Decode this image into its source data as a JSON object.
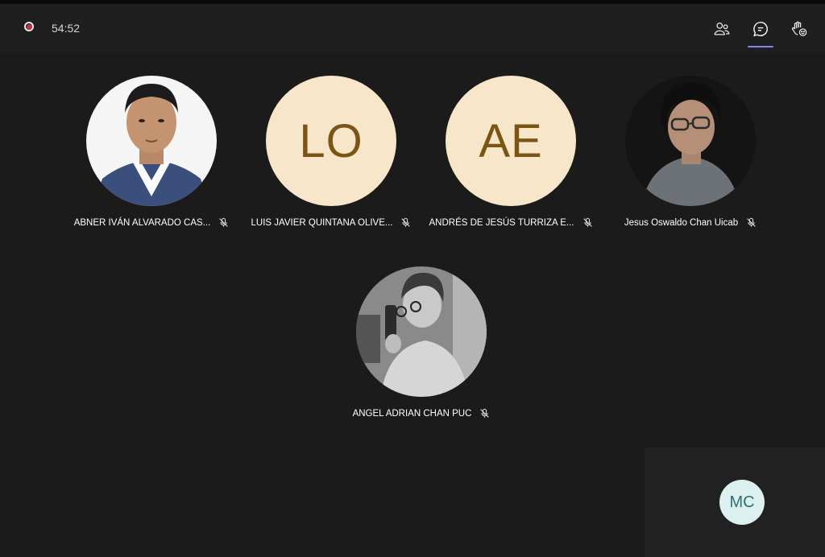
{
  "call": {
    "timer": "54:52",
    "recording_indicator_icon": "record-icon",
    "toolbar": [
      {
        "name": "participants",
        "icon": "people-icon"
      },
      {
        "name": "chat",
        "icon": "chat-icon",
        "active": true
      },
      {
        "name": "react",
        "icon": "raise-hand-icon"
      }
    ]
  },
  "participants": [
    {
      "name": "ABNER IVÁN ALVARADO CAS...",
      "type": "photo",
      "muted": true
    },
    {
      "name": "LUIS JAVIER QUINTANA OLIVE...",
      "type": "initials",
      "initials": "LO",
      "muted": true
    },
    {
      "name": "ANDRÉS DE JESÚS TURRIZA E...",
      "type": "initials",
      "initials": "AE",
      "muted": true
    },
    {
      "name": "Jesus Oswaldo Chan Uicab",
      "type": "photo",
      "muted": true
    },
    {
      "name": "ANGEL ADRIAN CHAN PUC",
      "type": "photo",
      "muted": true
    }
  ],
  "self_view": {
    "initials": "MC"
  },
  "colors": {
    "background": "#1b1b1b",
    "initials_bg": "#f7e6c9",
    "initials_fg": "#7a5514",
    "self_bg": "#dcf0ef",
    "self_fg": "#2f6e73",
    "recording": "#c4314b",
    "accent": "#7f85f5"
  }
}
